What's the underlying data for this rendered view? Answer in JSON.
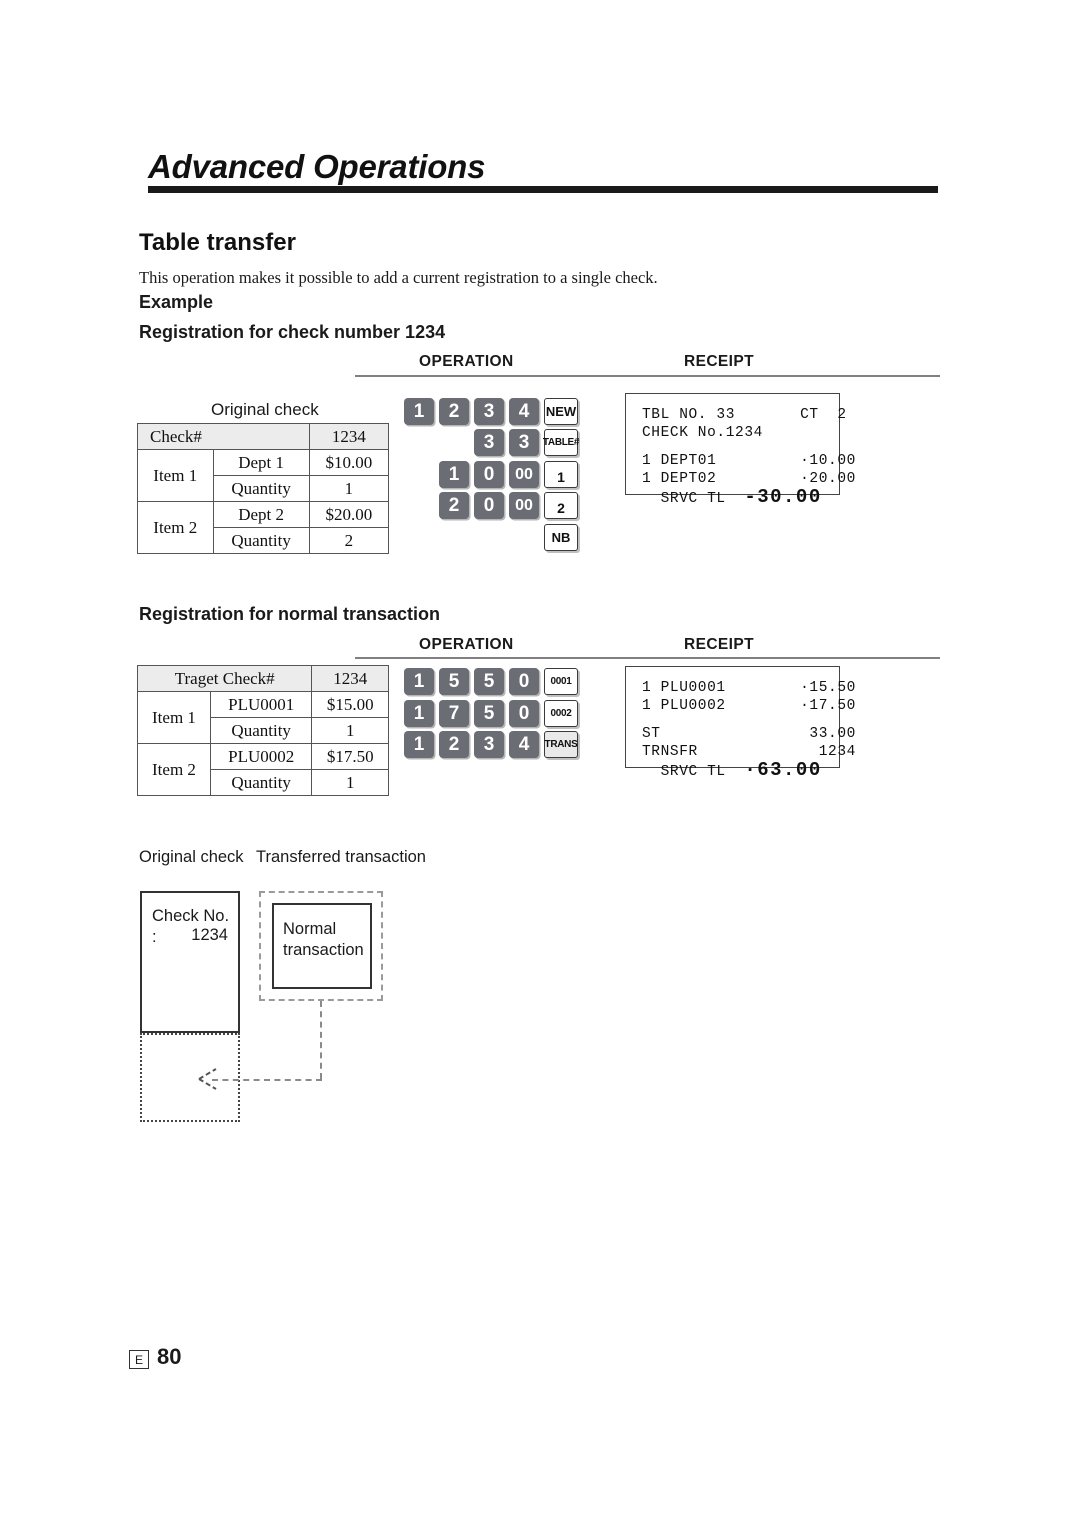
{
  "chapter": {
    "title": "Advanced Operations"
  },
  "section": {
    "title": "Table transfer",
    "intro": "This operation makes it possible to add a current registration to a single check.",
    "example_label": "Example"
  },
  "blocks": [
    {
      "heading": "Registration for check number 1234",
      "col_heads": {
        "operation": "OPERATION",
        "receipt": "RECEIPT"
      },
      "table": {
        "caption": "Original check",
        "header": {
          "label": "Check#",
          "value": "1234"
        },
        "rows": [
          {
            "item": "Item 1",
            "name": "Dept 1",
            "value": "$10.00"
          },
          {
            "item": "",
            "name": "Quantity",
            "value": "1"
          },
          {
            "item": "Item 2",
            "name": "Dept 2",
            "value": "$20.00"
          },
          {
            "item": "",
            "name": "Quantity",
            "value": "2"
          }
        ]
      },
      "key_rows": [
        {
          "indent": 0,
          "keys": [
            {
              "t": "num",
              "l": "1"
            },
            {
              "t": "num",
              "l": "2"
            },
            {
              "t": "num",
              "l": "3"
            },
            {
              "t": "num",
              "l": "4"
            },
            {
              "t": "fn",
              "l": "NEW"
            }
          ]
        },
        {
          "indent": 2,
          "keys": [
            {
              "t": "num",
              "l": "3"
            },
            {
              "t": "num",
              "l": "3"
            },
            {
              "t": "fn",
              "l": "TABLE#",
              "tiny": true
            }
          ]
        },
        {
          "indent": 1,
          "keys": [
            {
              "t": "num",
              "l": "1"
            },
            {
              "t": "num",
              "l": "0"
            },
            {
              "t": "num",
              "l": "00",
              "wide": true
            },
            {
              "t": "fn",
              "l": "1",
              "numfn": true
            }
          ]
        },
        {
          "indent": 1,
          "keys": [
            {
              "t": "num",
              "l": "2"
            },
            {
              "t": "num",
              "l": "0"
            },
            {
              "t": "num",
              "l": "00",
              "wide": true
            },
            {
              "t": "fn",
              "l": "2",
              "numfn": true
            }
          ]
        },
        {
          "indent": 4,
          "keys": [
            {
              "t": "fn",
              "l": "NB"
            }
          ]
        }
      ],
      "receipt_lines": [
        {
          "text": "TBL NO. 33       CT  2"
        },
        {
          "text": "CHECK No.1234"
        },
        {
          "blank": true
        },
        {
          "text": "1 DEPT01         ·10.00"
        },
        {
          "text": "1 DEPT02         ·20.00"
        },
        {
          "pre": "  SRVC TL  ",
          "big": "-30.00"
        }
      ]
    },
    {
      "heading": "Registration for normal transaction",
      "col_heads": {
        "operation": "OPERATION",
        "receipt": "RECEIPT"
      },
      "table": {
        "caption": "",
        "header": {
          "label": "Traget Check#",
          "value": "1234"
        },
        "rows": [
          {
            "item": "Item 1",
            "name": "PLU0001",
            "value": "$15.00"
          },
          {
            "item": "",
            "name": "Quantity",
            "value": "1"
          },
          {
            "item": "Item 2",
            "name": "PLU0002",
            "value": "$17.50"
          },
          {
            "item": "",
            "name": "Quantity",
            "value": "1"
          }
        ]
      },
      "key_rows": [
        {
          "indent": 0,
          "keys": [
            {
              "t": "num",
              "l": "1"
            },
            {
              "t": "num",
              "l": "5"
            },
            {
              "t": "num",
              "l": "5"
            },
            {
              "t": "num",
              "l": "0"
            },
            {
              "t": "fn",
              "l": "0001",
              "tiny": true
            }
          ]
        },
        {
          "indent": 0,
          "keys": [
            {
              "t": "num",
              "l": "1"
            },
            {
              "t": "num",
              "l": "7"
            },
            {
              "t": "num",
              "l": "5"
            },
            {
              "t": "num",
              "l": "0"
            },
            {
              "t": "fn",
              "l": "0002",
              "tiny": true
            }
          ]
        },
        {
          "indent": 0,
          "keys": [
            {
              "t": "num",
              "l": "1"
            },
            {
              "t": "num",
              "l": "2"
            },
            {
              "t": "num",
              "l": "3"
            },
            {
              "t": "num",
              "l": "4"
            },
            {
              "t": "fn",
              "l": "TRANS",
              "tiny": true,
              "shade": true
            }
          ]
        }
      ],
      "receipt_lines": [
        {
          "text": "1 PLU0001        ·15.50"
        },
        {
          "text": "1 PLU0002        ·17.50"
        },
        {
          "blank": true
        },
        {
          "text": "ST                33.00"
        },
        {
          "text": "TRNSFR             1234"
        },
        {
          "pre": "  SRVC TL  ",
          "big": "·63.00"
        }
      ]
    }
  ],
  "diagram": {
    "label_original": "Original check",
    "label_transferred": "Transferred transaction",
    "check_box_line1": "Check No. :",
    "check_box_line2": "1234",
    "normal_box_line1": "Normal",
    "normal_box_line2": "transaction"
  },
  "footer": {
    "lang": "E",
    "page": "80"
  }
}
